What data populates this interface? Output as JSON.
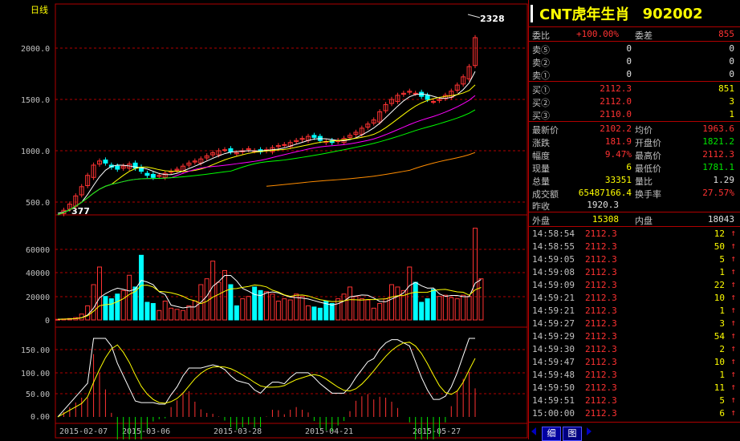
{
  "chart_panel": {
    "period_label": "日线",
    "peak_label": "2328",
    "low_label": "377",
    "price_axis": [
      "2000.0",
      "1500.0",
      "1000.0",
      "500.0"
    ],
    "volume_axis": [
      "60000",
      "40000",
      "20000",
      "0"
    ],
    "indicator_axis": [
      "150.00",
      "100.00",
      "50.00",
      "0.00"
    ],
    "dates": [
      "2015-02-07",
      "2015-03-06",
      "2015-03-28",
      "2015-04-21",
      "2015-05-27"
    ]
  },
  "chart_data": [
    {
      "type": "candlestick",
      "title": "日线",
      "ylim": [
        377,
        2328
      ],
      "annotations": [
        "2328",
        "377"
      ],
      "ticks": [
        "2000.0",
        "1500.0",
        "1000.0",
        "500.0"
      ],
      "x_ticks": [
        "2015-02-07",
        "2015-03-06",
        "2015-03-28",
        "2015-04-21",
        "2015-05-27"
      ],
      "close": [
        377,
        420,
        480,
        560,
        650,
        760,
        860,
        900,
        880,
        840,
        820,
        850,
        870,
        830,
        800,
        760,
        740,
        760,
        780,
        800,
        820,
        850,
        880,
        900,
        920,
        950,
        980,
        1000,
        1010,
        990,
        980,
        1000,
        1020,
        1000,
        990,
        1010,
        1030,
        1050,
        1060,
        1080,
        1100,
        1120,
        1140,
        1130,
        1100,
        1090,
        1080,
        1100,
        1120,
        1150,
        1180,
        1220,
        1260,
        1300,
        1380,
        1450,
        1500,
        1540,
        1560,
        1580,
        1560,
        1530,
        1500,
        1480,
        1500,
        1540,
        1580,
        1640,
        1720,
        1820,
        2102
      ]
    },
    {
      "type": "bar",
      "title": "",
      "ylim": [
        0,
        70000
      ],
      "ticks": [
        "60000",
        "40000",
        "20000",
        "0"
      ],
      "values": [
        500,
        800,
        1200,
        2000,
        5000,
        12000,
        30000,
        45000,
        20000,
        18000,
        22000,
        25000,
        38000,
        28000,
        55000,
        15000,
        14000,
        8000,
        16000,
        10000,
        9000,
        8000,
        12000,
        16000,
        30000,
        35000,
        50000,
        32000,
        42000,
        30000,
        12000,
        18000,
        20000,
        28000,
        25000,
        24000,
        22000,
        16000,
        18000,
        17000,
        22000,
        20000,
        12000,
        11000,
        10000,
        16000,
        14000,
        18000,
        22000,
        28000,
        20000,
        18000,
        17000,
        10000,
        14000,
        18000,
        30000,
        28000,
        25000,
        45000,
        32000,
        15000,
        18000,
        26000,
        20000,
        21000,
        19000,
        18000,
        21000,
        20000,
        78000,
        35000
      ]
    },
    {
      "type": "line",
      "title": "",
      "ylim": [
        0,
        180
      ],
      "ticks": [
        "150.00",
        "100.00",
        "50.00",
        "0.00"
      ],
      "x_ticks": [
        "2015-02-07",
        "2015-03-06",
        "2015-03-28",
        "2015-04-21",
        "2015-05-27"
      ]
    }
  ],
  "quote": {
    "name": "CNT虎年生肖",
    "code": "902002",
    "order_ratio_label": "委比",
    "order_ratio": "+100.00%",
    "order_diff_label": "委差",
    "order_diff": "855",
    "asks": [
      {
        "label": "卖⑤",
        "price": "0",
        "vol": "0"
      },
      {
        "label": "卖②",
        "price": "0",
        "vol": "0"
      },
      {
        "label": "卖①",
        "price": "0",
        "vol": "0"
      }
    ],
    "bids": [
      {
        "label": "买①",
        "price": "2112.3",
        "vol": "851"
      },
      {
        "label": "买②",
        "price": "2112.0",
        "vol": "3"
      },
      {
        "label": "买③",
        "price": "2110.0",
        "vol": "1"
      }
    ],
    "stats": [
      {
        "l1": "最新价",
        "v1": "2102.2",
        "l2": "均价",
        "v2": "1963.6"
      },
      {
        "l1": "涨跌",
        "v1": "181.9",
        "l2": "开盘价",
        "v2": "1821.2"
      },
      {
        "l1": "幅度",
        "v1": "9.47%",
        "l2": "最高价",
        "v2": "2112.3"
      },
      {
        "l1": "现量",
        "v1": "6",
        "l2": "最低价",
        "v2": "1781.1"
      },
      {
        "l1": "总量",
        "v1": "33351",
        "l2": "量比",
        "v2": "1.29"
      },
      {
        "l1": "成交额",
        "v1": "65487166.4",
        "l2": "换手率",
        "v2": "27.57%"
      }
    ],
    "prev_close_label": "昨收",
    "prev_close": "1920.3",
    "outer_label": "外盘",
    "outer": "15308",
    "inner_label": "内盘",
    "inner": "18043"
  },
  "ticks": [
    {
      "time": "14:58:54",
      "price": "2112.3",
      "vol": "12"
    },
    {
      "time": "14:58:55",
      "price": "2112.3",
      "vol": "50"
    },
    {
      "time": "14:59:05",
      "price": "2112.3",
      "vol": "5"
    },
    {
      "time": "14:59:08",
      "price": "2112.3",
      "vol": "1"
    },
    {
      "time": "14:59:09",
      "price": "2112.3",
      "vol": "22"
    },
    {
      "time": "14:59:21",
      "price": "2112.3",
      "vol": "10"
    },
    {
      "time": "14:59:21",
      "price": "2112.3",
      "vol": "1"
    },
    {
      "time": "14:59:27",
      "price": "2112.3",
      "vol": "3"
    },
    {
      "time": "14:59:29",
      "price": "2112.3",
      "vol": "54"
    },
    {
      "time": "14:59:30",
      "price": "2112.3",
      "vol": "2"
    },
    {
      "time": "14:59:47",
      "price": "2112.3",
      "vol": "10"
    },
    {
      "time": "14:59:48",
      "price": "2112.3",
      "vol": "1"
    },
    {
      "time": "14:59:50",
      "price": "2112.3",
      "vol": "11"
    },
    {
      "time": "14:59:51",
      "price": "2112.3",
      "vol": "5"
    },
    {
      "time": "15:00:00",
      "price": "2112.3",
      "vol": "6"
    }
  ],
  "tabs": [
    "细",
    "图"
  ],
  "colors": {
    "up": "#ff3232",
    "down": "#00ffff",
    "grid": "#b00000",
    "label": "#ffff00"
  }
}
